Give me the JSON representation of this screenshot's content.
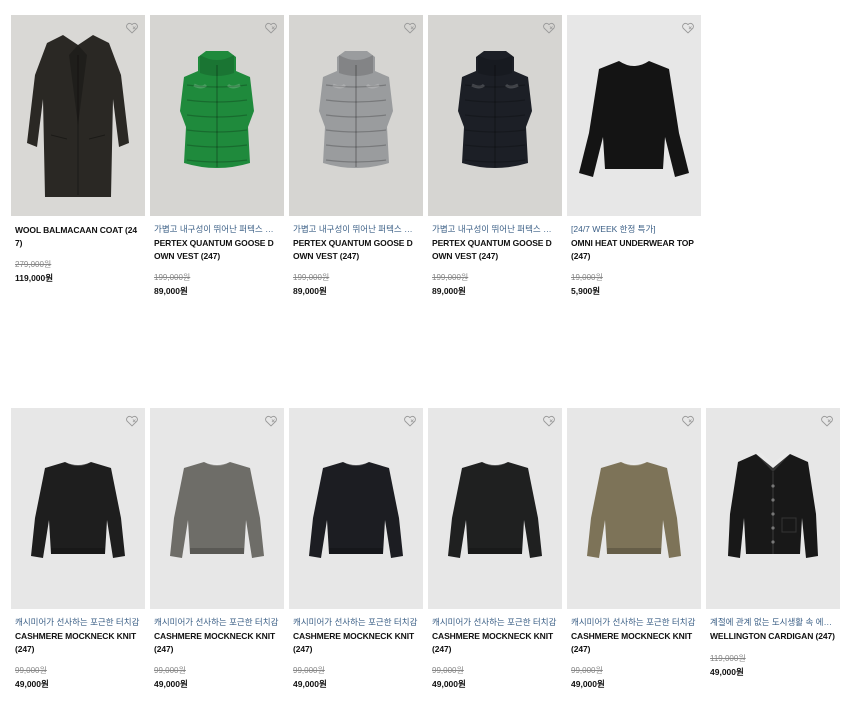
{
  "colors": {
    "tagline": "#3b5f86",
    "bg_grey": "#d4d3d0",
    "bg_light": "#e6e6e6"
  },
  "rows": [
    {
      "products": [
        {
          "tagline": "",
          "name": "WOOL BALMACAAN COAT (247)",
          "original_price": "279,000원",
          "price": "119,000원",
          "item": "coat",
          "color": "#2a2824",
          "bg": "#d9d8d5"
        },
        {
          "tagline": "가볍고 내구성이 뛰어난 퍼텍스 다운 베스트",
          "name": "PERTEX QUANTUM GOOSE DOWN VEST (247)",
          "original_price": "199,000원",
          "price": "89,000원",
          "item": "vest",
          "color": "#1f8a3c",
          "bg": "#d6d5d2"
        },
        {
          "tagline": "가볍고 내구성이 뛰어난 퍼텍스 다운 베스트",
          "name": "PERTEX QUANTUM GOOSE DOWN VEST (247)",
          "original_price": "199,000원",
          "price": "89,000원",
          "item": "vest",
          "color": "#9a9c9e",
          "bg": "#d6d5d2"
        },
        {
          "tagline": "가볍고 내구성이 뛰어난 퍼텍스 다운 베스트",
          "name": "PERTEX QUANTUM GOOSE DOWN VEST (247)",
          "original_price": "199,000원",
          "price": "89,000원",
          "item": "vest",
          "color": "#1c1f26",
          "bg": "#d6d5d2"
        },
        {
          "tagline": "[24/7 WEEK 한정 특가]",
          "name": "OMNI HEAT UNDERWEAR TOP (247)",
          "original_price": "19,000원",
          "price": "5,900원",
          "item": "tee",
          "color": "#141414",
          "bg": "#e7e7e7"
        }
      ]
    },
    {
      "products": [
        {
          "tagline": "캐시미어가 선사하는 포근한 터치감",
          "name": "CASHMERE MOCKNECK KNIT (247)",
          "original_price": "99,000원",
          "price": "49,000원",
          "item": "knit",
          "color": "#1e1e1e",
          "bg": "#e7e7e7"
        },
        {
          "tagline": "캐시미어가 선사하는 포근한 터치감",
          "name": "CASHMERE MOCKNECK KNIT (247)",
          "original_price": "99,000원",
          "price": "49,000원",
          "item": "knit",
          "color": "#6e6d68",
          "bg": "#e7e7e7"
        },
        {
          "tagline": "캐시미어가 선사하는 포근한 터치감",
          "name": "CASHMERE MOCKNECK KNIT (247)",
          "original_price": "99,000원",
          "price": "49,000원",
          "item": "knit",
          "color": "#1c1d22",
          "bg": "#e7e7e7"
        },
        {
          "tagline": "캐시미어가 선사하는 포근한 터치감",
          "name": "CASHMERE MOCKNECK KNIT (247)",
          "original_price": "99,000원",
          "price": "49,000원",
          "item": "knit",
          "color": "#1f2020",
          "bg": "#e7e7e7"
        },
        {
          "tagline": "캐시미어가 선사하는 포근한 터치감",
          "name": "CASHMERE MOCKNECK KNIT (247)",
          "original_price": "99,000원",
          "price": "49,000원",
          "item": "knit",
          "color": "#7d7358",
          "bg": "#e7e7e7"
        },
        {
          "tagline": "계절에 관계 없는 도시생활 속 에센셜 니트 가디건",
          "name": "WELLINGTON CARDIGAN (247)",
          "original_price": "119,000원",
          "price": "49,000원",
          "item": "cardigan",
          "color": "#181818",
          "bg": "#e7e7e7"
        }
      ]
    }
  ]
}
